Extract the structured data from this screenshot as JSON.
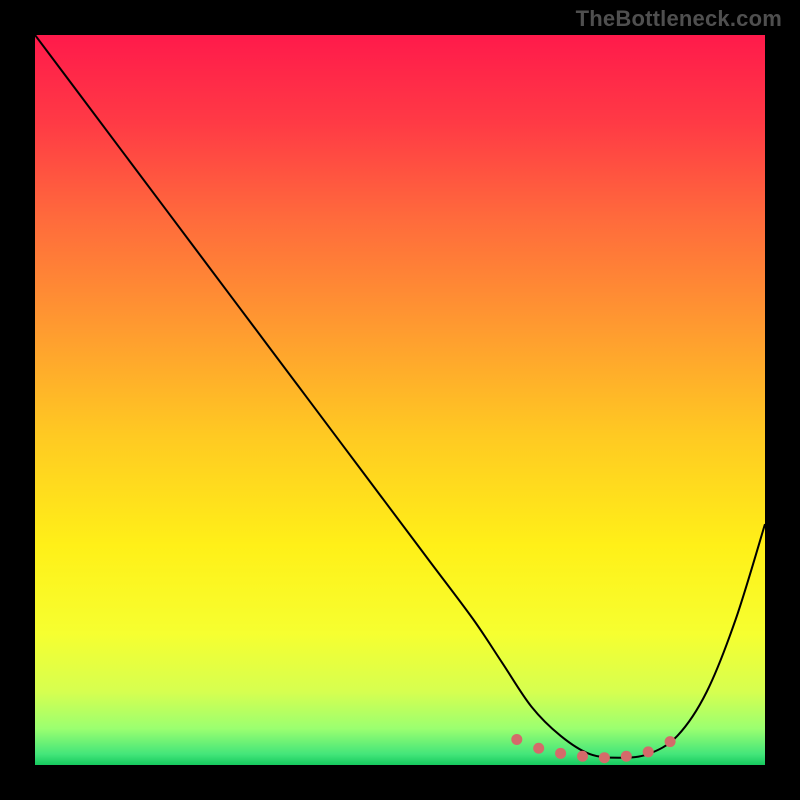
{
  "watermark": "TheBottleneck.com",
  "chart_data": {
    "type": "line",
    "title": "",
    "xlabel": "",
    "ylabel": "",
    "xlim": [
      0,
      100
    ],
    "ylim": [
      0,
      100
    ],
    "grid": false,
    "background_gradient": {
      "stops": [
        {
          "pos": 0.0,
          "color": "#ff1a4b"
        },
        {
          "pos": 0.12,
          "color": "#ff3a45"
        },
        {
          "pos": 0.25,
          "color": "#ff6a3c"
        },
        {
          "pos": 0.4,
          "color": "#ff9a30"
        },
        {
          "pos": 0.55,
          "color": "#ffca22"
        },
        {
          "pos": 0.7,
          "color": "#fff018"
        },
        {
          "pos": 0.82,
          "color": "#f6ff30"
        },
        {
          "pos": 0.9,
          "color": "#d6ff50"
        },
        {
          "pos": 0.95,
          "color": "#9bff70"
        },
        {
          "pos": 0.985,
          "color": "#44e67a"
        },
        {
          "pos": 1.0,
          "color": "#16c95e"
        }
      ]
    },
    "series": [
      {
        "name": "bottleneck-curve",
        "color": "#000000",
        "stroke_width": 2,
        "x": [
          0,
          6,
          12,
          18,
          24,
          30,
          36,
          42,
          48,
          54,
          60,
          64,
          68,
          72,
          76,
          80,
          84,
          88,
          92,
          96,
          100
        ],
        "y": [
          100,
          92,
          84,
          76,
          68,
          60,
          52,
          44,
          36,
          28,
          20,
          14,
          8,
          4,
          1.5,
          1,
          1.5,
          4,
          10,
          20,
          33
        ]
      }
    ],
    "markers": {
      "name": "highlight-region",
      "color": "#d46a6a",
      "radius": 5.5,
      "x": [
        66,
        69,
        72,
        75,
        78,
        81,
        84,
        87
      ],
      "y": [
        3.5,
        2.3,
        1.6,
        1.2,
        1.0,
        1.2,
        1.8,
        3.2
      ]
    }
  }
}
